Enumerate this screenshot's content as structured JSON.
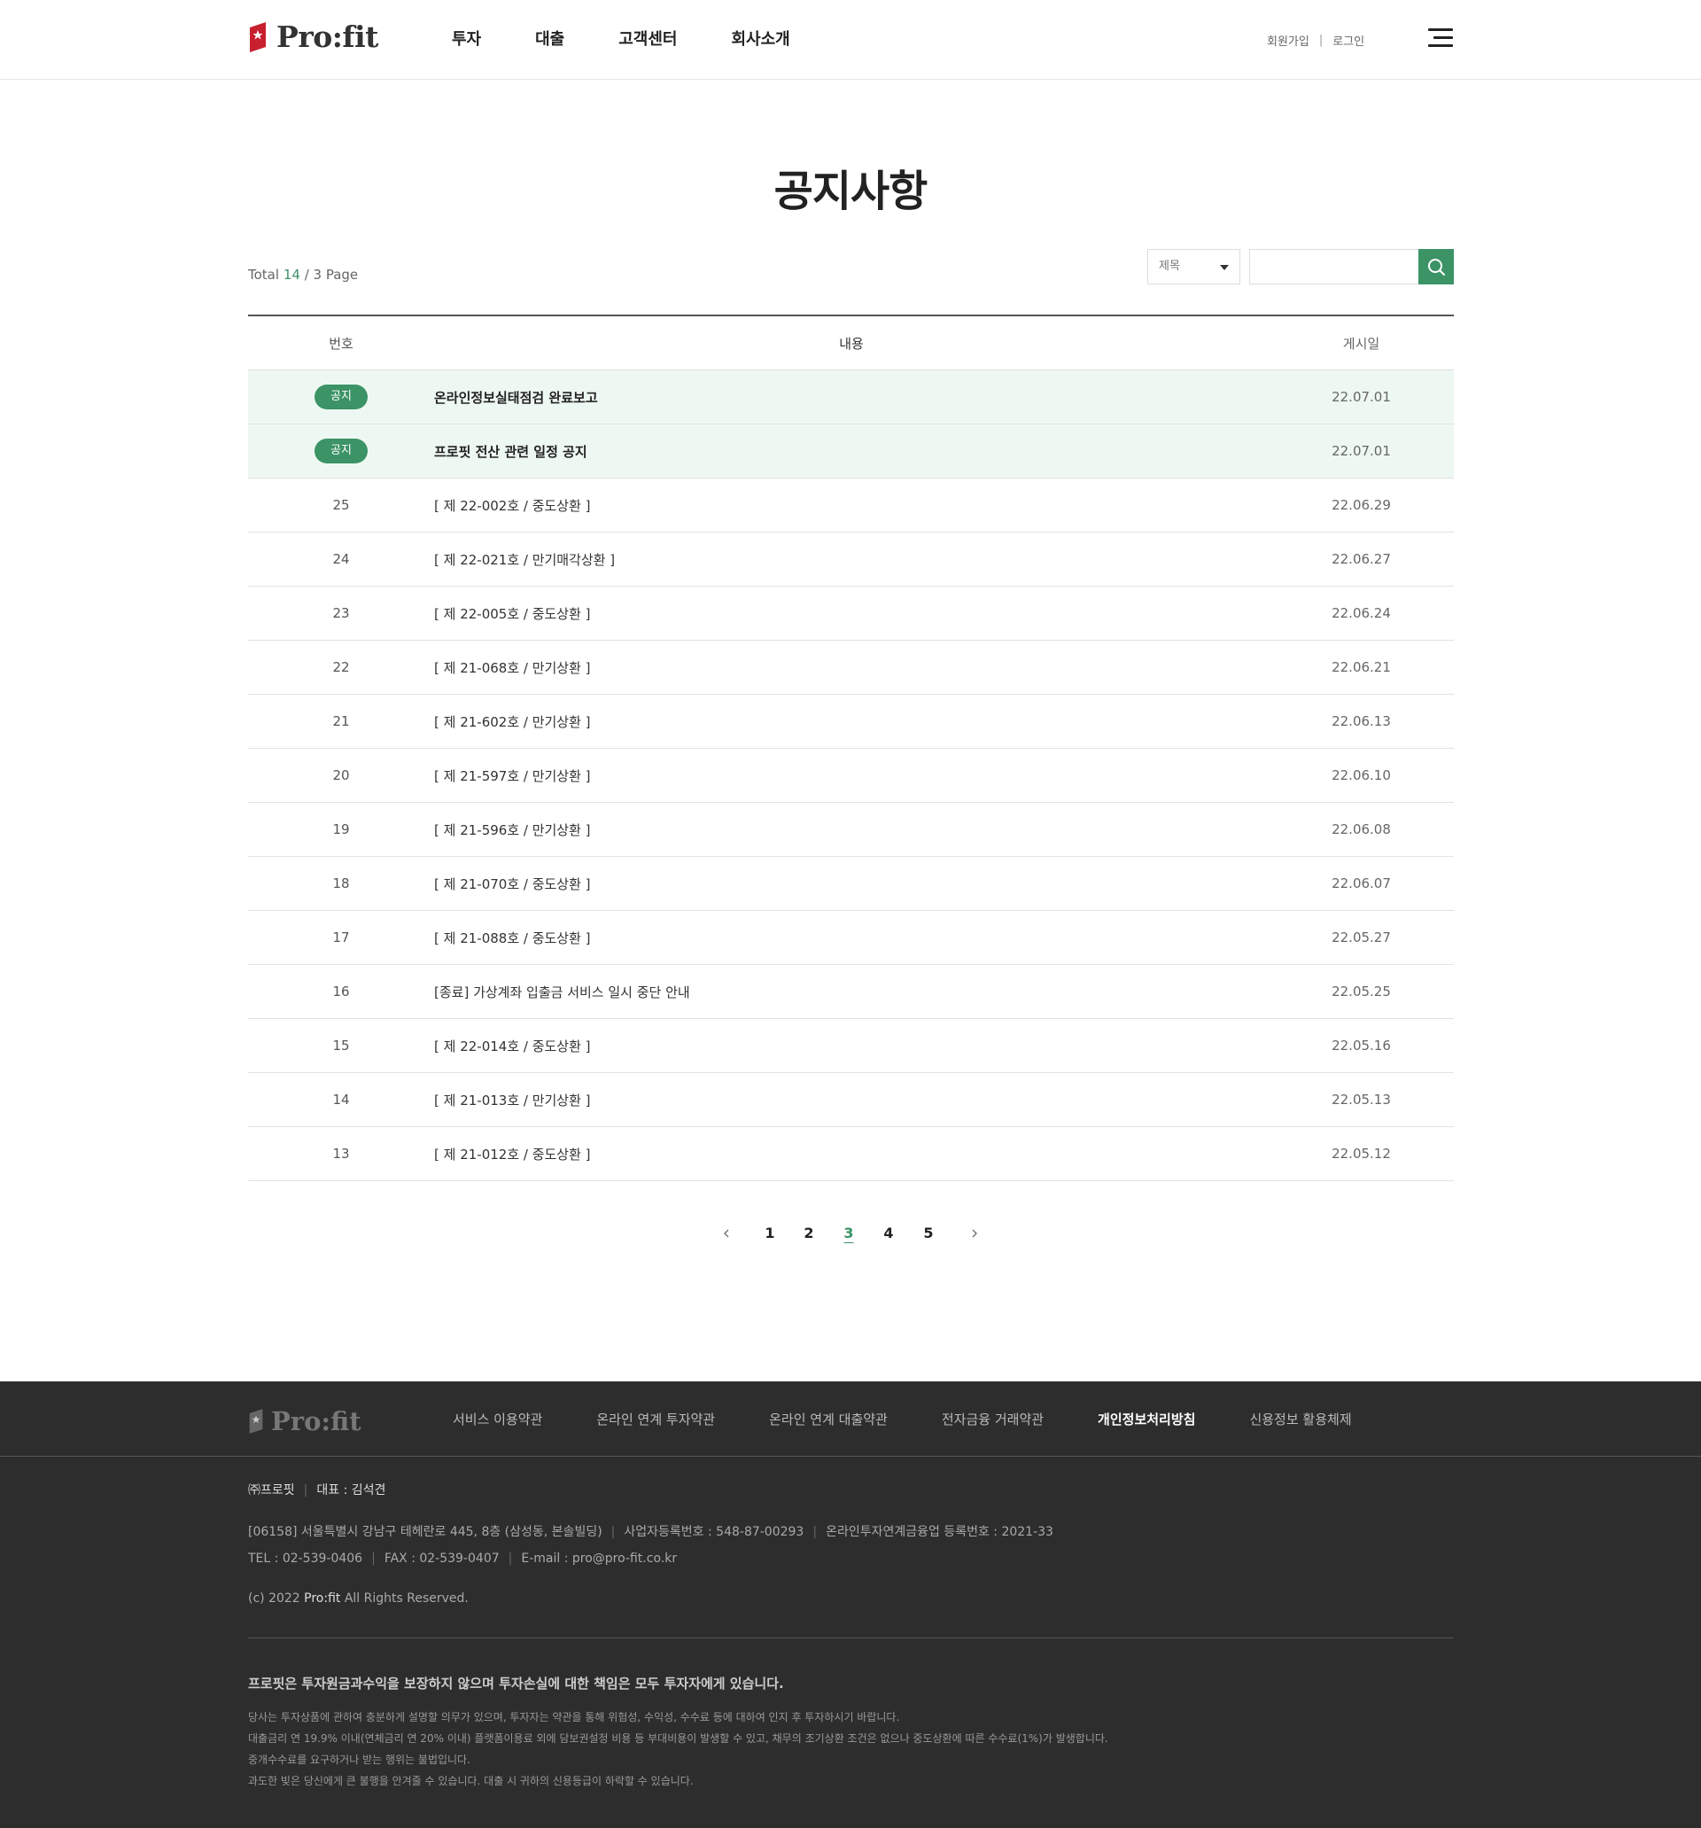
{
  "header": {
    "logo_text": "Pro:fit",
    "nav": [
      "투자",
      "대출",
      "고객센터",
      "회사소개"
    ],
    "util": {
      "signup": "회원가입",
      "separator": "|",
      "login": "로그인"
    }
  },
  "page": {
    "title": "공지사항",
    "total_label": "Total",
    "total_count": "14",
    "page_text": "/  3 Page",
    "search_select": "제목",
    "search_placeholder": ""
  },
  "table": {
    "headers": {
      "no": "번호",
      "title": "내용",
      "date": "게시일"
    },
    "notice_badge": "공지",
    "rows": [
      {
        "no": "공지",
        "title": "온라인정보실태점검 완료보고",
        "date": "22.07.01",
        "notice": true
      },
      {
        "no": "공지",
        "title": "프로핏 전산 관련 일정 공지",
        "date": "22.07.01",
        "notice": true
      },
      {
        "no": "25",
        "title": "[ 제 22-002호 / 중도상환 ]",
        "date": "22.06.29"
      },
      {
        "no": "24",
        "title": "[ 제 22-021호 / 만기매각상환 ]",
        "date": "22.06.27"
      },
      {
        "no": "23",
        "title": "[ 제 22-005호 / 중도상환 ]",
        "date": "22.06.24"
      },
      {
        "no": "22",
        "title": "[ 제 21-068호 / 만기상환 ]",
        "date": "22.06.21"
      },
      {
        "no": "21",
        "title": "[ 제 21-602호 / 만기상환 ]",
        "date": "22.06.13"
      },
      {
        "no": "20",
        "title": "[ 제 21-597호 / 만기상환 ]",
        "date": "22.06.10"
      },
      {
        "no": "19",
        "title": "[ 제 21-596호 / 만기상환 ]",
        "date": "22.06.08"
      },
      {
        "no": "18",
        "title": "[ 제 21-070호 / 중도상환 ]",
        "date": "22.06.07"
      },
      {
        "no": "17",
        "title": "[ 제 21-088호 / 중도상환 ]",
        "date": "22.05.27"
      },
      {
        "no": "16",
        "title": "[종료] 가상계좌 입출금 서비스 일시 중단 안내",
        "date": "22.05.25"
      },
      {
        "no": "15",
        "title": "[ 제 22-014호 / 중도상환 ]",
        "date": "22.05.16"
      },
      {
        "no": "14",
        "title": "[ 제 21-013호 / 만기상환 ]",
        "date": "22.05.13"
      },
      {
        "no": "13",
        "title": "[ 제 21-012호 / 중도상환 ]",
        "date": "22.05.12"
      }
    ]
  },
  "pagination": {
    "pages": [
      "1",
      "2",
      "3",
      "4",
      "5"
    ],
    "active": "3",
    "prev_icon": "chevron-left-icon",
    "next_icon": "chevron-right-icon"
  },
  "footer": {
    "logo_text": "Pro:fit",
    "links": [
      "서비스 이용약관",
      "온라인 연계 투자약관",
      "온라인 연계 대출약관",
      "전자금융 거래약관",
      "개인정보처리방침",
      "신용정보 활용체제"
    ],
    "company": "㈜프로핏",
    "ceo": "대표 : 김석견",
    "address": "[06158] 서울특별시 강남구 테헤란로 445, 8층 (삼성동, 본솔빌딩)",
    "biz_no": "사업자등록번호 : 548-87-00293",
    "reg_no": "온라인투자연계금융업 등록번호 : 2021-33",
    "tel": "TEL : 02-539-0406",
    "fax": "FAX : 02-539-0407",
    "email": "E-mail : pro@pro-fit.co.kr",
    "copyright_pre": "(c) 2022 ",
    "copyright_brand": "Pro:fit",
    "copyright_post": " All Rights Reserved.",
    "warning": "프로핏은 투자원금과수익을 보장하지 않으며 투자손실에 대한 책임은 모두 투자자에게 있습니다.",
    "desc": [
      "당사는 투자상품에 관하여 충분하게 설명할 의무가 있으며, 투자자는 약관을 통해 위험성, 수익성, 수수료 등에 대하여 인지 후 투자하시기 바랍니다.",
      "대출금리 연 19.9% 이내(연체금리 연 20% 이내) 플랫폼이용료 외에 담보권설정 비용 등 부대비용이 발생할 수 있고, 채무의 조기상환 조건은 없으나 중도상환에 따른 수수료(1%)가 발생합니다.",
      "중개수수료를 요구하거나 받는 행위는 불법입니다.",
      "과도한 빚은 당신에게 큰 불행을 안겨줄 수 있습니다. 대출 시 귀하의 신용등급이 하락할 수 있습니다."
    ]
  },
  "colors": {
    "accent": "#3b9366",
    "notice_bg": "#eef8f2",
    "footer_bg": "#2d2d2d",
    "logo_red": "#c8202f"
  }
}
